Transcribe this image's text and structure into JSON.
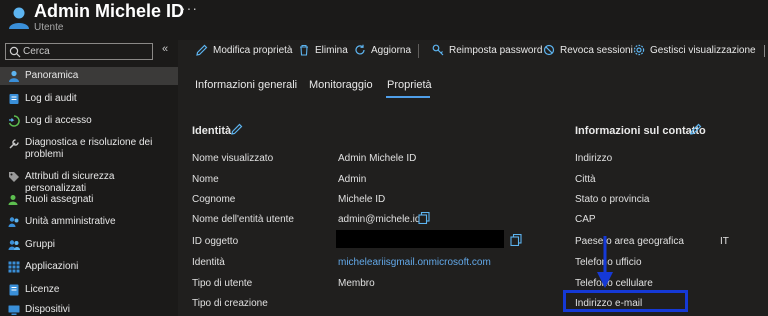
{
  "header": {
    "title": "Admin Michele ID",
    "more": "···",
    "subtitle": "Utente"
  },
  "sidebar": {
    "search_placeholder": "Cerca",
    "collapse": "«",
    "items": [
      {
        "label": "Panoramica",
        "icon": "person-icon",
        "active": true
      },
      {
        "label": "Log di audit",
        "icon": "audit-log-icon"
      },
      {
        "label": "Log di accesso",
        "icon": "sign-in-icon"
      },
      {
        "label": "Diagnostica e risoluzione dei problemi",
        "icon": "wrench-icon"
      },
      {
        "label": "Attributi di sicurezza personalizzati",
        "icon": "tag-icon"
      },
      {
        "label": "Ruoli assegnati",
        "icon": "roles-icon"
      },
      {
        "label": "Unità amministrative",
        "icon": "admin-units-icon"
      },
      {
        "label": "Gruppi",
        "icon": "groups-icon"
      },
      {
        "label": "Applicazioni",
        "icon": "apps-grid-icon"
      },
      {
        "label": "Licenze",
        "icon": "license-icon"
      },
      {
        "label": "Dispositivi",
        "icon": "device-icon"
      }
    ]
  },
  "toolbar": {
    "edit": "Modifica proprietà",
    "delete": "Elimina",
    "refresh": "Aggiorna",
    "reset_password": "Reimposta password",
    "revoke_sessions": "Revoca sessioni",
    "manage_view": "Gestisci visualizzazione"
  },
  "tabs": [
    "Informazioni generali",
    "Monitoraggio",
    "Proprietà"
  ],
  "identity": {
    "title": "Identità",
    "rows": [
      {
        "label": "Nome visualizzato",
        "value": "Admin Michele ID"
      },
      {
        "label": "Nome",
        "value": "Admin"
      },
      {
        "label": "Cognome",
        "value": "Michele ID"
      },
      {
        "label": "Nome dell'entità utente",
        "value": "admin@michele.id"
      },
      {
        "label": "ID oggetto",
        "value": ""
      },
      {
        "label": "Identità",
        "value": "micheleariisgmail.onmicrosoft.com"
      },
      {
        "label": "Tipo di utente",
        "value": "Membro"
      },
      {
        "label": "Tipo di creazione",
        "value": ""
      }
    ]
  },
  "contact": {
    "title": "Informazioni sul contatto",
    "rows": [
      {
        "label": "Indirizzo",
        "value": ""
      },
      {
        "label": "Città",
        "value": ""
      },
      {
        "label": "Stato o provincia",
        "value": ""
      },
      {
        "label": "CAP",
        "value": ""
      },
      {
        "label": "Paese o area geografica",
        "value": "IT"
      },
      {
        "label": "Telefono ufficio",
        "value": ""
      },
      {
        "label": "Telefono cellulare",
        "value": ""
      },
      {
        "label": "Indirizzo e-mail",
        "value": ""
      }
    ]
  },
  "colors": {
    "accent": "#4f9ee8",
    "link": "#62a8e8",
    "annotation": "#1539d6",
    "background": "#1b1a19"
  }
}
